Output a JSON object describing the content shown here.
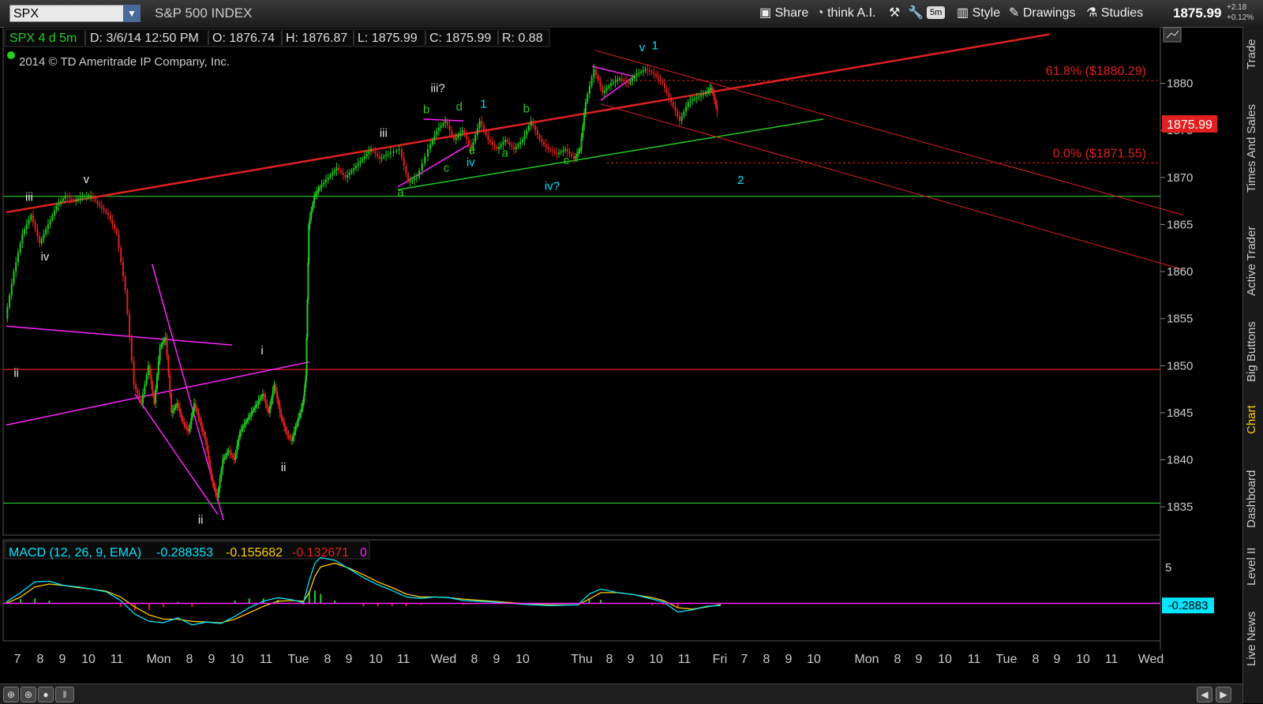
{
  "toolbar": {
    "symbol": "SPX",
    "index_name": "S&P 500 INDEX",
    "share_label": "Share",
    "think_ai_label": "think A.I.",
    "timeframe_label": "5m",
    "style_label": "Style",
    "drawings_label": "Drawings",
    "studies_label": "Studies",
    "last_price": "1875.99",
    "change_abs": "+2.18",
    "change_pct": "+0.12%"
  },
  "sidebar_tabs": [
    "Trade",
    "Times And Sales",
    "Active Trader",
    "Big Buttons",
    "Chart",
    "Dashboard",
    "Level II",
    "Live News"
  ],
  "colors": {
    "up": "#22cc22",
    "down": "#e02020",
    "accent": "#00e5ff",
    "highlight": "#ffcc00",
    "magenta": "#ff22ff"
  },
  "chart_data": {
    "type": "candlestick",
    "header": {
      "symbol_period": "SPX 4 d 5m",
      "date": "D: 3/6/14 12:50 PM",
      "open": "O: 1876.74",
      "high": "H: 1876.87",
      "low": "L: 1875.99",
      "close": "C: 1875.99",
      "range": "R: 0.88"
    },
    "copyright": "2014 © TD Ameritrade IP Company, Inc.",
    "ylim": [
      1832,
      1886
    ],
    "y_ticks": [
      1835,
      1840,
      1845,
      1850,
      1855,
      1860,
      1865,
      1870,
      1875,
      1880
    ],
    "price_label": "1875.99",
    "x_ticks": [
      "7",
      "8",
      "9",
      "10",
      "11",
      "Mon",
      "8",
      "9",
      "10",
      "11",
      "Tue",
      "8",
      "9",
      "10",
      "11",
      "Wed",
      "8",
      "9",
      "10",
      "Thu",
      "8",
      "9",
      "10",
      "11",
      "Fri",
      "7",
      "8",
      "9",
      "10",
      "Mon",
      "8",
      "9",
      "10",
      "11",
      "Tue",
      "8",
      "9",
      "10",
      "11",
      "Wed"
    ],
    "price_path": [
      [
        0,
        1855
      ],
      [
        0.3,
        1860
      ],
      [
        0.6,
        1864
      ],
      [
        0.9,
        1866
      ],
      [
        1.2,
        1863
      ],
      [
        1.5,
        1865
      ],
      [
        1.8,
        1867
      ],
      [
        2.1,
        1868
      ],
      [
        2.4,
        1867.5
      ],
      [
        2.7,
        1868
      ],
      [
        3.0,
        1868
      ],
      [
        3.3,
        1867
      ],
      [
        3.6,
        1866
      ],
      [
        3.9,
        1864
      ],
      [
        4.2,
        1858
      ],
      [
        4.5,
        1848
      ],
      [
        4.75,
        1846
      ],
      [
        5.0,
        1850
      ],
      [
        5.2,
        1846
      ],
      [
        5.4,
        1852
      ],
      [
        5.6,
        1853
      ],
      [
        5.8,
        1845
      ],
      [
        6.0,
        1846
      ],
      [
        6.2,
        1844
      ],
      [
        6.4,
        1843
      ],
      [
        6.6,
        1846
      ],
      [
        6.8,
        1844
      ],
      [
        7.0,
        1842
      ],
      [
        7.2,
        1838
      ],
      [
        7.4,
        1836
      ],
      [
        7.6,
        1840
      ],
      [
        7.8,
        1841
      ],
      [
        8.0,
        1840
      ],
      [
        8.2,
        1843
      ],
      [
        8.4,
        1844
      ],
      [
        8.6,
        1845
      ],
      [
        8.8,
        1846
      ],
      [
        9.0,
        1847
      ],
      [
        9.2,
        1845
      ],
      [
        9.4,
        1848
      ],
      [
        9.6,
        1845
      ],
      [
        9.8,
        1843
      ],
      [
        10.0,
        1842
      ],
      [
        10.2,
        1844
      ],
      [
        10.4,
        1846
      ],
      [
        10.5,
        1849
      ],
      [
        10.6,
        1865
      ],
      [
        10.8,
        1868
      ],
      [
        11.0,
        1869
      ],
      [
        11.3,
        1870
      ],
      [
        11.6,
        1871
      ],
      [
        11.9,
        1870
      ],
      [
        12.2,
        1871
      ],
      [
        12.5,
        1872
      ],
      [
        12.8,
        1873
      ],
      [
        13.1,
        1872
      ],
      [
        13.4,
        1872.5
      ],
      [
        13.8,
        1873
      ],
      [
        14.1,
        1869.5
      ],
      [
        14.4,
        1870
      ],
      [
        14.8,
        1873
      ],
      [
        15.1,
        1875
      ],
      [
        15.4,
        1876
      ],
      [
        15.7,
        1874
      ],
      [
        16.0,
        1875
      ],
      [
        16.3,
        1873
      ],
      [
        16.6,
        1876
      ],
      [
        16.9,
        1874
      ],
      [
        17.2,
        1873
      ],
      [
        17.5,
        1874
      ],
      [
        17.8,
        1873
      ],
      [
        18.1,
        1874
      ],
      [
        18.4,
        1876
      ],
      [
        18.7,
        1874
      ],
      [
        19.0,
        1873
      ],
      [
        19.3,
        1872.5
      ],
      [
        19.6,
        1873
      ],
      [
        19.9,
        1872
      ],
      [
        20.1,
        1873
      ],
      [
        20.3,
        1878
      ],
      [
        20.6,
        1881.5
      ],
      [
        20.9,
        1879
      ],
      [
        21.2,
        1880
      ],
      [
        21.5,
        1880.5
      ],
      [
        21.8,
        1880
      ],
      [
        22.1,
        1881
      ],
      [
        22.4,
        1881.5
      ],
      [
        22.7,
        1881
      ],
      [
        23.0,
        1880
      ],
      [
        23.3,
        1878
      ],
      [
        23.6,
        1876
      ],
      [
        23.9,
        1878
      ],
      [
        24.2,
        1878.5
      ],
      [
        24.5,
        1879
      ],
      [
        24.7,
        1879.5
      ],
      [
        24.9,
        1877
      ]
    ],
    "fib_levels": [
      {
        "label": "61.8%  ($1880.29)",
        "value": 1880.29
      },
      {
        "label": "0.0%  ($1871.55)",
        "value": 1871.55
      }
    ],
    "horizontal_lines": [
      {
        "value": 1868,
        "color": "green"
      },
      {
        "value": 1849.6,
        "color": "red"
      },
      {
        "value": 1835.4,
        "color": "green"
      }
    ],
    "trendlines": [
      {
        "from": [
          0,
          1866.3
        ],
        "to": [
          36.5,
          1885.2
        ],
        "color": "red",
        "width": 2.5
      },
      {
        "from": [
          13.7,
          1868.7
        ],
        "to": [
          28.6,
          1876.2
        ],
        "color": "green",
        "width": 1.5
      },
      {
        "from": [
          20.6,
          1883.5
        ],
        "to": [
          41.2,
          1866
        ],
        "color": "red",
        "width": 1
      },
      {
        "from": [
          20.8,
          1877.8
        ],
        "to": [
          41.2,
          1860.2
        ],
        "color": "red",
        "width": 1
      },
      {
        "from": [
          0,
          1854.2
        ],
        "to": [
          7.9,
          1852.2
        ],
        "color": "magenta",
        "width": 1.5
      },
      {
        "from": [
          0,
          1843.7
        ],
        "to": [
          10.6,
          1850.4
        ],
        "color": "magenta",
        "width": 1.5
      },
      {
        "from": [
          5.1,
          1860.8
        ],
        "to": [
          7.6,
          1833.6
        ],
        "color": "magenta",
        "width": 1.5
      },
      {
        "from": [
          4.5,
          1847
        ],
        "to": [
          7.4,
          1834.2
        ],
        "color": "magenta",
        "width": 1.5
      },
      {
        "from": [
          13.7,
          1869
        ],
        "to": [
          16.2,
          1873.5
        ],
        "color": "magenta",
        "width": 1.5
      },
      {
        "from": [
          14.6,
          1876.2
        ],
        "to": [
          16.0,
          1876.0
        ],
        "color": "magenta",
        "width": 1.5
      },
      {
        "from": [
          20.5,
          1881.8
        ],
        "to": [
          22.0,
          1880.7
        ],
        "color": "magenta",
        "width": 1.5
      },
      {
        "from": [
          20.8,
          1878.2
        ],
        "to": [
          22.0,
          1880.8
        ],
        "color": "magenta",
        "width": 1.5
      }
    ],
    "wave_labels": [
      {
        "text": "iii",
        "x": 0.8,
        "y": 1867.5,
        "color": "white"
      },
      {
        "text": "v",
        "x": 2.8,
        "y": 1869.4,
        "color": "white"
      },
      {
        "text": "iv",
        "x": 1.35,
        "y": 1861.2,
        "color": "white"
      },
      {
        "text": "ii",
        "x": 0.35,
        "y": 1848.8,
        "color": "white"
      },
      {
        "text": "i",
        "x": 8.95,
        "y": 1851.2,
        "color": "white"
      },
      {
        "text": "ii",
        "x": 6.8,
        "y": 1833.2,
        "color": "white"
      },
      {
        "text": "ii",
        "x": 9.7,
        "y": 1838.8,
        "color": "white"
      },
      {
        "text": "iii",
        "x": 13.2,
        "y": 1874.3,
        "color": "white"
      },
      {
        "text": "iii?",
        "x": 15.1,
        "y": 1879.1,
        "color": "white"
      },
      {
        "text": "b",
        "x": 14.7,
        "y": 1876.8,
        "color": "green"
      },
      {
        "text": "d",
        "x": 15.85,
        "y": 1877.1,
        "color": "green"
      },
      {
        "text": "e",
        "x": 16.3,
        "y": 1872.5,
        "color": "green"
      },
      {
        "text": "c",
        "x": 15.4,
        "y": 1870.6,
        "color": "green"
      },
      {
        "text": "a",
        "x": 13.8,
        "y": 1868,
        "color": "green"
      },
      {
        "text": "1",
        "x": 16.7,
        "y": 1877.4,
        "color": "cyan"
      },
      {
        "text": "iv",
        "x": 16.25,
        "y": 1871.2,
        "color": "cyan"
      },
      {
        "text": "a",
        "x": 17.45,
        "y": 1872.2,
        "color": "green"
      },
      {
        "text": "b",
        "x": 18.2,
        "y": 1876.9,
        "color": "green"
      },
      {
        "text": "c",
        "x": 19.6,
        "y": 1871.4,
        "color": "green"
      },
      {
        "text": "iv?",
        "x": 19.1,
        "y": 1868.7,
        "color": "cyan"
      },
      {
        "text": "v",
        "x": 22.25,
        "y": 1883.4,
        "color": "cyan"
      },
      {
        "text": "1",
        "x": 22.7,
        "y": 1883.6,
        "color": "cyan"
      },
      {
        "text": "2",
        "x": 25.7,
        "y": 1869.3,
        "color": "cyan"
      }
    ],
    "macd": {
      "title": "MACD (12, 26, 9, EMA)",
      "value": "-0.288353",
      "avg": "-0.155682",
      "diff": "-0.132671",
      "zero": "0",
      "ylim": [
        -5,
        6
      ],
      "y_tick_label": "5",
      "current_label": "-0.2883",
      "value_series": [
        [
          0,
          0.2
        ],
        [
          0.5,
          1.5
        ],
        [
          1,
          3
        ],
        [
          1.5,
          3.1
        ],
        [
          2,
          2.5
        ],
        [
          2.5,
          2.3
        ],
        [
          3,
          2
        ],
        [
          3.5,
          1.6
        ],
        [
          4,
          0.4
        ],
        [
          4.5,
          -1.5
        ],
        [
          5,
          -2.5
        ],
        [
          5.5,
          -2.7
        ],
        [
          6,
          -2
        ],
        [
          6.5,
          -3
        ],
        [
          7,
          -2.6
        ],
        [
          7.5,
          -2.8
        ],
        [
          8,
          -1.8
        ],
        [
          8.5,
          -0.6
        ],
        [
          9,
          0.3
        ],
        [
          9.5,
          0.8
        ],
        [
          10,
          0.5
        ],
        [
          10.4,
          0.1
        ],
        [
          10.6,
          3.2
        ],
        [
          10.8,
          5.6
        ],
        [
          11,
          6.4
        ],
        [
          11.5,
          6
        ],
        [
          12,
          4.8
        ],
        [
          12.5,
          3.6
        ],
        [
          13,
          2.6
        ],
        [
          13.5,
          1.8
        ],
        [
          14,
          0.9
        ],
        [
          14.5,
          0.7
        ],
        [
          15,
          0.9
        ],
        [
          15.5,
          0.8
        ],
        [
          16,
          0.4
        ],
        [
          17,
          0.2
        ],
        [
          18,
          -0.1
        ],
        [
          19,
          -0.3
        ],
        [
          20,
          -0.2
        ],
        [
          20.4,
          1.3
        ],
        [
          20.8,
          2
        ],
        [
          21.4,
          1.5
        ],
        [
          22,
          1.2
        ],
        [
          22.6,
          0.6
        ],
        [
          23,
          0.2
        ],
        [
          23.5,
          -1.2
        ],
        [
          24,
          -0.9
        ],
        [
          24.5,
          -0.4
        ],
        [
          25,
          -0.29
        ]
      ],
      "avg_series": [
        [
          0,
          0
        ],
        [
          0.5,
          0.9
        ],
        [
          1,
          2.3
        ],
        [
          1.5,
          2.7
        ],
        [
          2,
          2.5
        ],
        [
          2.5,
          2.2
        ],
        [
          3,
          2
        ],
        [
          3.5,
          1.7
        ],
        [
          4,
          0.9
        ],
        [
          4.5,
          -0.5
        ],
        [
          5,
          -1.6
        ],
        [
          5.5,
          -2.2
        ],
        [
          6,
          -2.2
        ],
        [
          6.5,
          -2.5
        ],
        [
          7,
          -2.6
        ],
        [
          7.5,
          -2.7
        ],
        [
          8,
          -2.2
        ],
        [
          8.5,
          -1.3
        ],
        [
          9,
          -0.4
        ],
        [
          9.5,
          0.3
        ],
        [
          10,
          0.4
        ],
        [
          10.4,
          0.3
        ],
        [
          10.6,
          1.5
        ],
        [
          10.8,
          3.8
        ],
        [
          11,
          5.1
        ],
        [
          11.5,
          5.6
        ],
        [
          12,
          4.9
        ],
        [
          12.5,
          4
        ],
        [
          13,
          3
        ],
        [
          13.5,
          2.2
        ],
        [
          14,
          1.3
        ],
        [
          14.5,
          0.9
        ],
        [
          15,
          0.9
        ],
        [
          15.5,
          0.8
        ],
        [
          16,
          0.6
        ],
        [
          17,
          0.3
        ],
        [
          18,
          0
        ],
        [
          19,
          -0.2
        ],
        [
          20,
          -0.2
        ],
        [
          20.4,
          0.6
        ],
        [
          20.8,
          1.5
        ],
        [
          21.4,
          1.5
        ],
        [
          22,
          1.2
        ],
        [
          22.6,
          0.8
        ],
        [
          23,
          0.4
        ],
        [
          23.5,
          -0.6
        ],
        [
          24,
          -0.8
        ],
        [
          24.5,
          -0.5
        ],
        [
          25,
          -0.16
        ]
      ]
    }
  }
}
